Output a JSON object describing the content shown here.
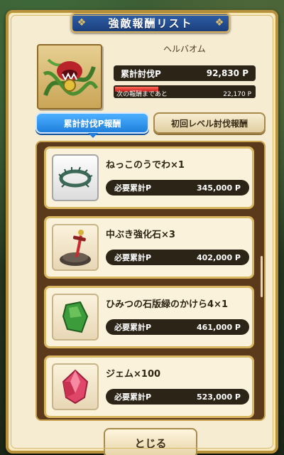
{
  "title": "強敵報酬リスト",
  "monster": {
    "name": "ヘルバオム",
    "points_label": "累計討伐P",
    "points_value": "92,830 P",
    "next_label": "次の報酬まであと",
    "next_value": "22,170 P",
    "progress_fraction": 0.31
  },
  "tabs": [
    {
      "label": "累計討伐P報酬",
      "active": true
    },
    {
      "label": "初回レベル討伐報酬",
      "active": false
    }
  ],
  "rewards": [
    {
      "name": "ねっこのうでわ×1",
      "req_label": "必要累計P",
      "req_value": "345,000 P",
      "icon": "root-bracelet-icon"
    },
    {
      "name": "中ぶき強化石×3",
      "req_label": "必要累計P",
      "req_value": "402,000 P",
      "icon": "sword-stone-icon"
    },
    {
      "name": "ひみつの石版緑のかけら4×1",
      "req_label": "必要累計P",
      "req_value": "461,000 P",
      "icon": "green-tablet-icon"
    },
    {
      "name": "ジェム×100",
      "req_label": "必要累計P",
      "req_value": "523,000 P",
      "icon": "gem-icon"
    }
  ],
  "close_label": "とじる"
}
